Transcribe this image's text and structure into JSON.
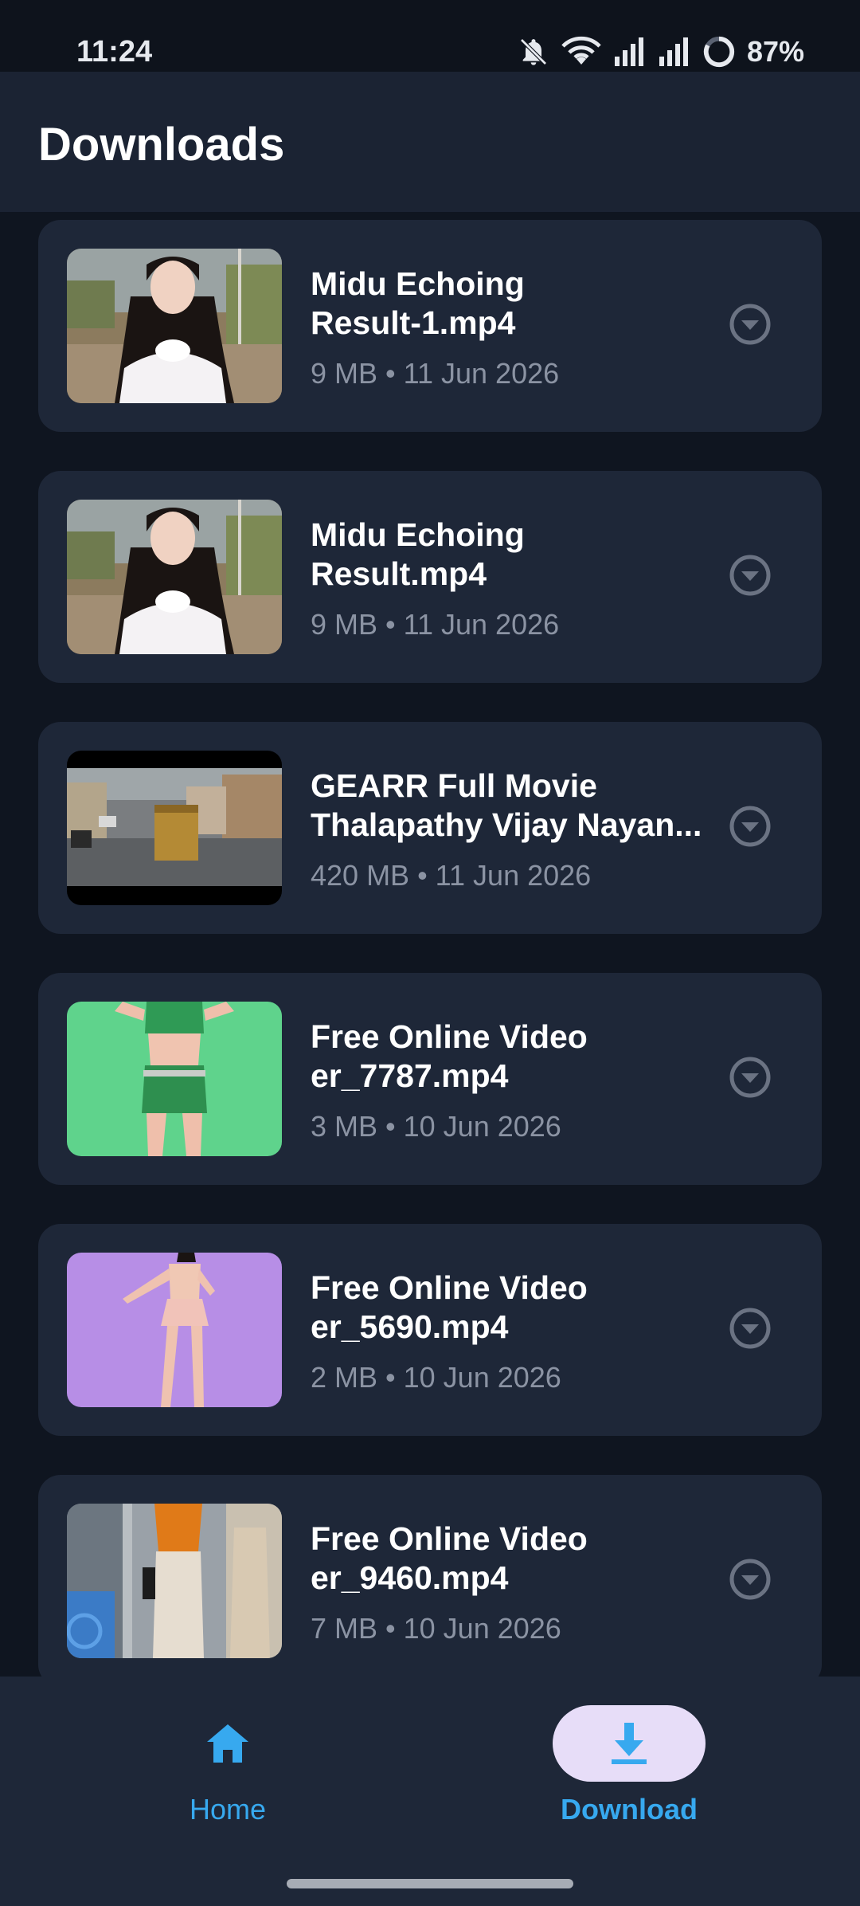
{
  "status_bar": {
    "time": "11:24",
    "battery": "87%",
    "icons": [
      "bell-off-icon",
      "wifi-icon",
      "signal-icon",
      "signal-icon",
      "battery-ring-icon"
    ]
  },
  "header": {
    "title": "Downloads"
  },
  "downloads": [
    {
      "title": "Midu Echoing\nResult-1.mp4",
      "meta": "9 MB • 11 Jun 2026",
      "thumb": "girl-outdoor"
    },
    {
      "title": "Midu Echoing\nResult.mp4",
      "meta": "9 MB • 11 Jun 2026",
      "thumb": "girl-outdoor"
    },
    {
      "title": "GEARR Full Movie\nThalapathy Vijay Nayan...",
      "meta": "420 MB • 11 Jun 2026",
      "thumb": "street-scene"
    },
    {
      "title": "Free Online Video\ner_7787.mp4",
      "meta": "3 MB • 10 Jun 2026",
      "thumb": "green-screen"
    },
    {
      "title": "Free Online Video\ner_5690.mp4",
      "meta": "2 MB • 10 Jun 2026",
      "thumb": "purple-screen"
    },
    {
      "title": "Free Online Video\ner_9460.mp4",
      "meta": "7 MB • 10 Jun 2026",
      "thumb": "street-walk"
    }
  ],
  "bottom_nav": {
    "home_label": "Home",
    "download_label": "Download",
    "active": "download"
  },
  "colors": {
    "accent": "#37a9ef",
    "card": "#1e2738",
    "background": "#0f1520",
    "active_pill": "#e7ddf8"
  }
}
